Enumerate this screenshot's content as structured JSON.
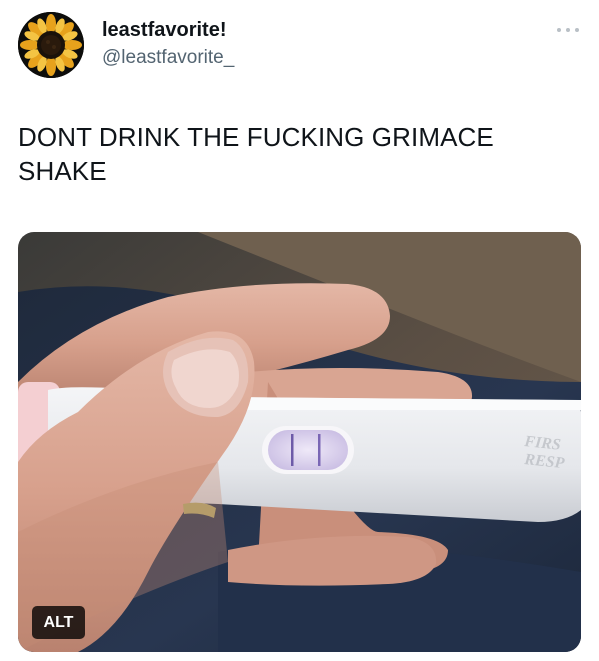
{
  "author": {
    "display_name": "leastfavorite!",
    "handle": "@leastfavorite_",
    "avatar_icon": "sunflower-avatar"
  },
  "post": {
    "text": "DONT DRINK THE FUCKING GRIMACE SHAKE"
  },
  "media": {
    "alt_label": "ALT",
    "test_brand_text": "FIRST RESP"
  },
  "colors": {
    "text": "#0f1419",
    "secondary": "#536471",
    "more_dots": "#b9c0c6",
    "alt_badge_bg": "#000000"
  }
}
